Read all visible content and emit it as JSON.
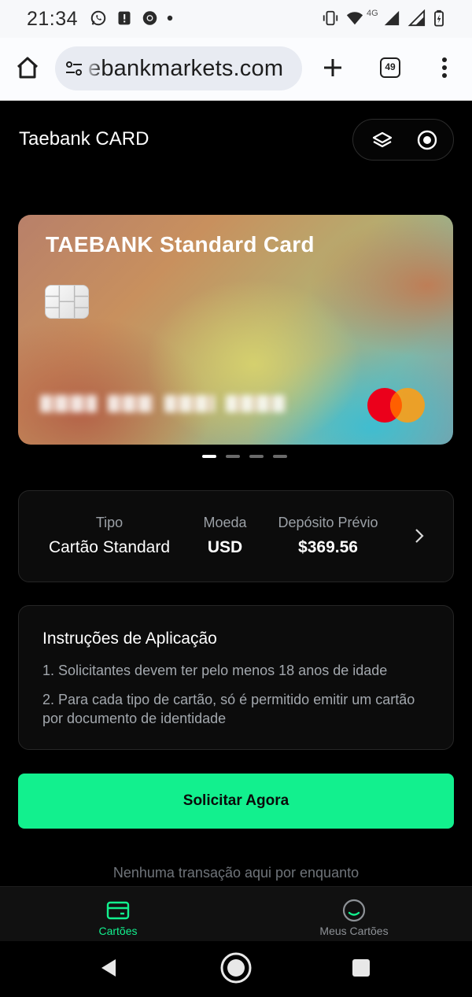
{
  "status_bar": {
    "time": "21:34",
    "network": "4G",
    "icons": [
      "whatsapp-icon",
      "notification-icon",
      "chrome-icon",
      "dot-icon",
      "vibrate-icon",
      "wifi-icon",
      "signal-icon",
      "signal-icon",
      "battery-icon"
    ]
  },
  "browser": {
    "url": "ebankmarkets.com",
    "tab_count": "49",
    "icons": [
      "home-icon",
      "site-settings-icon",
      "new-tab-icon",
      "tabs-icon",
      "more-icon"
    ]
  },
  "app": {
    "title": "Taebank CARD",
    "header_icons": [
      "layers-icon",
      "record-icon"
    ]
  },
  "card": {
    "title": "TAEBANK Standard Card",
    "brand": "mastercard",
    "colors": {
      "mc_red": "#eb001b",
      "mc_orange": "#f79e1b"
    }
  },
  "pager": {
    "count": 4,
    "active": 0
  },
  "info": {
    "type_label": "Tipo",
    "type_value": "Cartão Standard",
    "currency_label": "Moeda",
    "currency_value": "USD",
    "deposit_label": "Depósito Prévio",
    "deposit_value": "$369.56"
  },
  "instructions": {
    "title": "Instruções de Aplicação",
    "items": [
      "1. Solicitantes devem ter pelo menos 18 anos de idade",
      "2. Para cada tipo de cartão, só é permitido emitir um cartão por documento de identidade"
    ]
  },
  "cta": {
    "label": "Solicitar Agora",
    "color": "#12f08e"
  },
  "empty_state": "Nenhuma transação aqui por enquanto",
  "bottom_nav": {
    "items": [
      {
        "label": "Cartões",
        "icon": "card-icon",
        "active": true
      },
      {
        "label": "Meus Cartões",
        "icon": "smile-icon",
        "active": false
      }
    ],
    "active_color": "#12f08e",
    "inactive_color": "#8d9196"
  },
  "system_nav": {
    "icons": [
      "back-icon",
      "home-circle-icon",
      "recents-icon"
    ]
  }
}
